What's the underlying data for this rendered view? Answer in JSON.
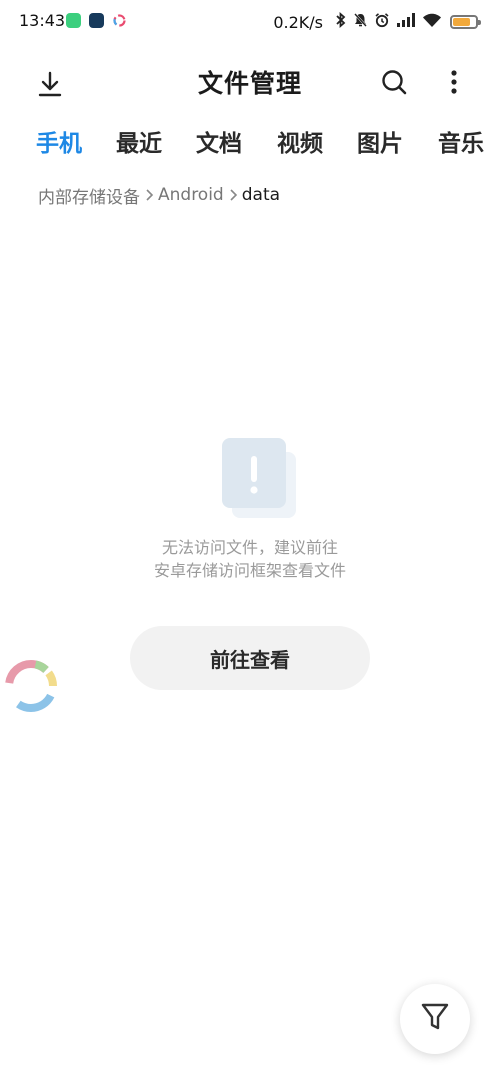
{
  "status_bar": {
    "time": "13:43",
    "net_speed": "0.2K/s",
    "icons": [
      "bluetooth-icon",
      "mute-icon",
      "alarm-icon",
      "signal-icon",
      "wifi-icon",
      "battery-icon"
    ],
    "battery_color": "#f2a93b",
    "battery_level": 0.75
  },
  "toolbar": {
    "title": "文件管理",
    "left_icon": "download-icon",
    "right_icons": [
      "search-icon",
      "more-vertical-icon"
    ]
  },
  "tabs": [
    {
      "label": "手机",
      "active": true
    },
    {
      "label": "最近",
      "active": false
    },
    {
      "label": "文档",
      "active": false
    },
    {
      "label": "视频",
      "active": false
    },
    {
      "label": "图片",
      "active": false
    },
    {
      "label": "音乐",
      "active": false
    }
  ],
  "accent_color": "#1e88e5",
  "breadcrumb": {
    "items": [
      "内部存储设备",
      "Android",
      "data"
    ]
  },
  "empty_state": {
    "icon": "warning-document-icon",
    "message_line1": "无法访问文件，建议前往",
    "message_line2": "安卓存储访问框架查看文件",
    "button_label": "前往查看"
  },
  "fab": {
    "icon": "filter-icon"
  }
}
